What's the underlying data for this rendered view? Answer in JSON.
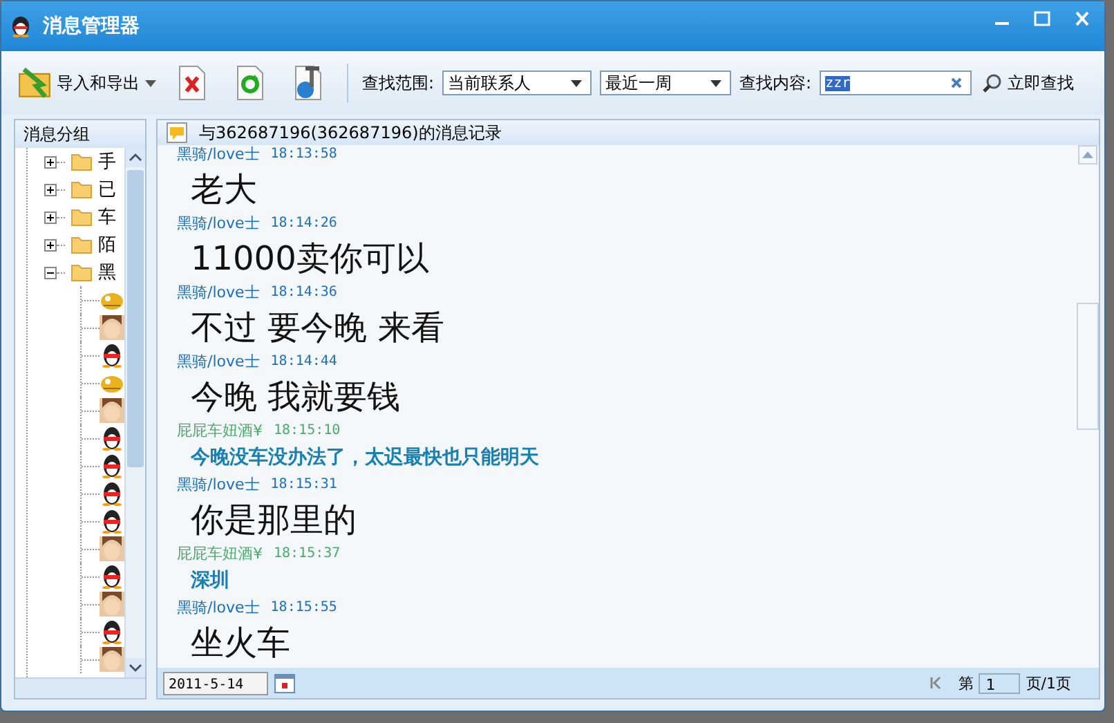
{
  "window": {
    "title": "消息管理器"
  },
  "toolbar": {
    "import_export": "导入和导出",
    "scope_label": "查找范围:",
    "scope": "当前联系人",
    "period": "最近一周",
    "content_label": "查找内容:",
    "search_value": "zzr",
    "search_button": "立即查找"
  },
  "sidebar": {
    "title": "消息分组",
    "groups": [
      {
        "label": "手",
        "expanded": false
      },
      {
        "label": "已",
        "expanded": false
      },
      {
        "label": "车",
        "expanded": false
      },
      {
        "label": "陌",
        "expanded": false
      },
      {
        "label": "黑",
        "expanded": true,
        "children": [
          {
            "kind": "creature"
          },
          {
            "kind": "face"
          },
          {
            "kind": "penguin"
          },
          {
            "kind": "creature"
          },
          {
            "kind": "face"
          },
          {
            "kind": "penguin"
          },
          {
            "kind": "penguin"
          },
          {
            "kind": "penguin"
          },
          {
            "kind": "penguin"
          },
          {
            "kind": "face"
          },
          {
            "kind": "penguin"
          },
          {
            "kind": "face"
          },
          {
            "kind": "penguin"
          },
          {
            "kind": "face"
          }
        ]
      }
    ]
  },
  "chat": {
    "title": "与362687196(362687196)的消息记录",
    "messages": [
      {
        "kind": "friend",
        "sender": "黑骑/love士",
        "time": "18:13:58",
        "text": "老大"
      },
      {
        "kind": "friend",
        "sender": "黑骑/love士",
        "time": "18:14:26",
        "text": "11000卖你可以"
      },
      {
        "kind": "friend",
        "sender": "黑骑/love士",
        "time": "18:14:36",
        "text": "不过 要今晚 来看"
      },
      {
        "kind": "friend",
        "sender": "黑骑/love士",
        "time": "18:14:44",
        "text": "今晚 我就要钱"
      },
      {
        "kind": "me",
        "sender": "屁屁车妞酒¥",
        "time": "18:15:10",
        "text": "今晚没车没办法了，太迟最快也只能明天"
      },
      {
        "kind": "friend",
        "sender": "黑骑/love士",
        "time": "18:15:31",
        "text": "你是那里的"
      },
      {
        "kind": "me",
        "sender": "屁屁车妞酒¥",
        "time": "18:15:37",
        "text": "深圳"
      },
      {
        "kind": "friend",
        "sender": "黑骑/love士",
        "time": "18:15:55",
        "text": "坐火车"
      }
    ]
  },
  "footer": {
    "date": "2011-5-14",
    "page_prefix": "第",
    "page": "1",
    "page_suffix": "页/1页"
  }
}
